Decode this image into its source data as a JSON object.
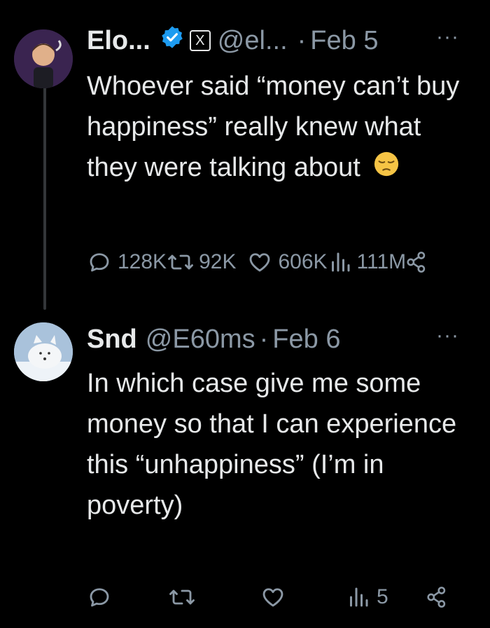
{
  "tweet": {
    "author_name": "Elo...",
    "handle": "@el...",
    "separator": "·",
    "date": "Feb 5",
    "badge_letter": "X",
    "text": "Whoever said “money can’t buy happiness” really knew what they were talking about",
    "emoji": "pensive-face",
    "stats": {
      "replies": "128K",
      "reposts": "92K",
      "likes": "606K",
      "views": "111M"
    }
  },
  "reply": {
    "author_name": "Snd",
    "handle": "@E60ms",
    "separator": "·",
    "date": "Feb 6",
    "text": "In which case give me some money so that I can experience this “unhappiness” (I’m in poverty)",
    "stats": {
      "views": "5"
    }
  },
  "more_label": "···",
  "colors": {
    "background": "#000000",
    "text": "#e7e9ea",
    "muted": "#8b98a5",
    "verified": "#1d9bf0",
    "thread_line": "#333639"
  }
}
